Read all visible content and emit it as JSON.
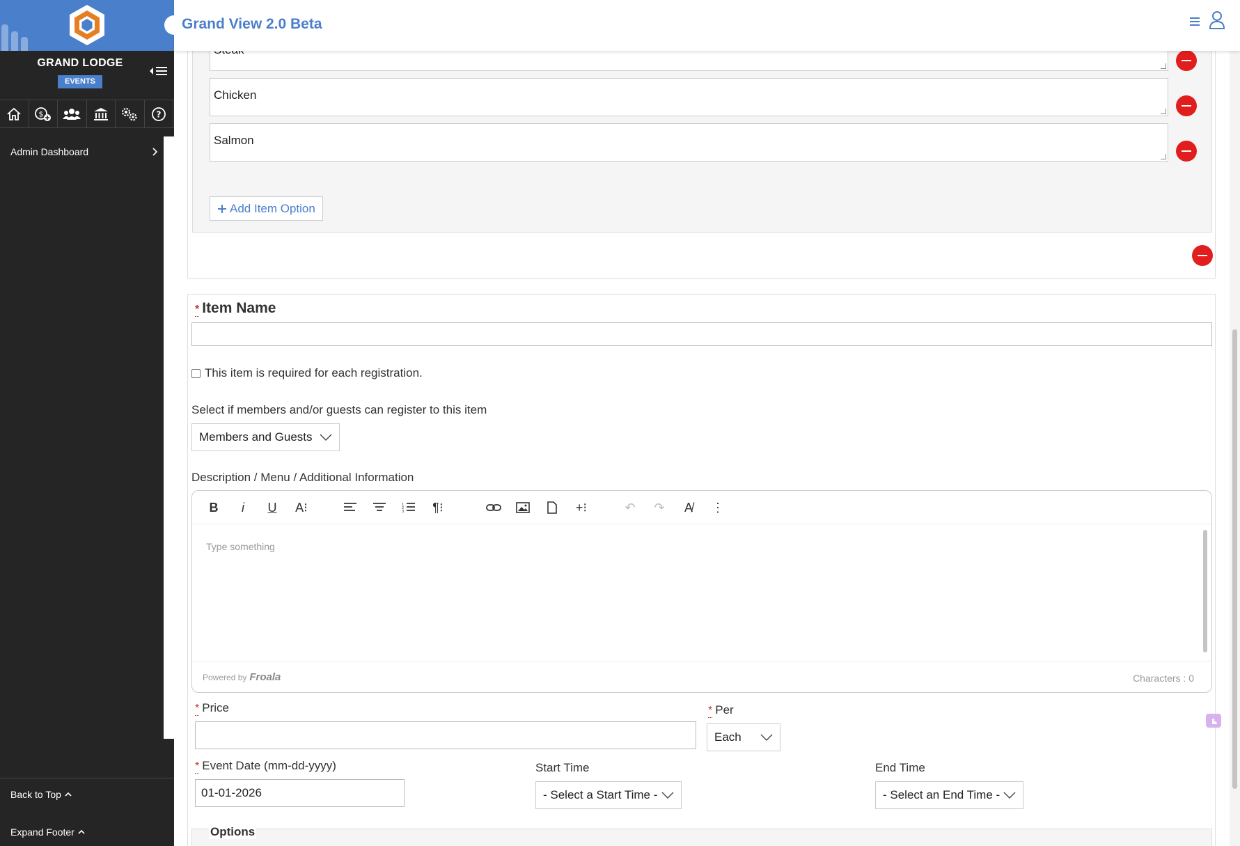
{
  "app": {
    "title": "Grand View 2.0 Beta"
  },
  "sidebar": {
    "org_name": "GRAND LODGE",
    "org_badge": "EVENTS",
    "nav_icons": [
      "home-icon",
      "money-add-icon",
      "users-icon",
      "bank-icon",
      "settings-icon",
      "help-icon"
    ],
    "admin_link": "Admin Dashboard",
    "back_to_top": "Back to Top",
    "expand_footer": "Expand Footer"
  },
  "item_options": [
    "Steak",
    "Chicken",
    "Salmon"
  ],
  "add_item_option": "Add Item Option",
  "form": {
    "item_name_label": "Item Name",
    "item_name_value": "",
    "required_checkbox_label": "This item is required for each registration.",
    "required_checked": false,
    "registrant_label": "Select if members and/or guests can register to this item",
    "registrant_value": "Members and Guests",
    "description_label": "Description / Menu / Additional Information",
    "editor_placeholder": "Type something",
    "powered_by": "Powered by",
    "editor_brand": "Froala",
    "characters": "Characters : 0",
    "price_label": "Price",
    "price_value": "",
    "per_label": "Per",
    "per_value": "Each",
    "event_date_label": "Event Date (mm-dd-yyyy)",
    "event_date_value": "01-01-2026",
    "start_time_label": "Start Time",
    "start_time_value": "- Select a Start Time -",
    "end_time_label": "End Time",
    "end_time_value": "- Select an End Time -",
    "options_legend": "Options"
  },
  "colors": {
    "brand_blue": "#4a7fcb",
    "sidebar_bg": "#252525",
    "remove_red": "#e21d1d",
    "required_red": "#c0392b",
    "logo_orange": "#e67e22"
  },
  "editor_toolbar": [
    "bold-icon",
    "italic-icon",
    "underline-icon",
    "font-size-icon",
    "align-left-icon",
    "align-center-icon",
    "ordered-list-icon",
    "paragraph-format-icon",
    "link-icon",
    "image-icon",
    "file-icon",
    "insert-more-icon",
    "undo-icon",
    "redo-icon",
    "spell-check-icon",
    "more-vertical-icon"
  ]
}
